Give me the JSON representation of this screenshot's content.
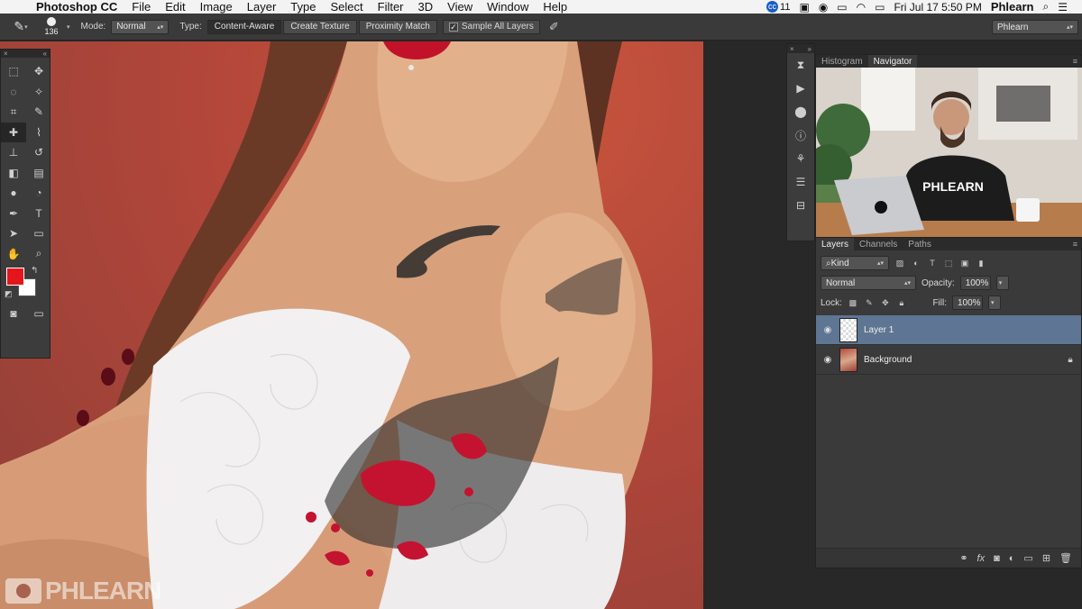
{
  "menubar": {
    "app_name": "Photoshop CC",
    "items": [
      "File",
      "Edit",
      "Image",
      "Layer",
      "Type",
      "Select",
      "Filter",
      "3D",
      "View",
      "Window",
      "Help"
    ],
    "cc_count": "11",
    "clock": "Fri Jul 17  5:50 PM",
    "user": "Phlearn"
  },
  "options": {
    "brush_size": "136",
    "mode_label": "Mode:",
    "mode_value": "Normal",
    "type_label": "Type:",
    "type_buttons": [
      "Content-Aware",
      "Create Texture",
      "Proximity Match"
    ],
    "sample_all_layers": "Sample All Layers",
    "workspace": "Phlearn"
  },
  "canvas": {
    "watermark": "PHLEARN"
  },
  "colors": {
    "foreground": "#e4161c",
    "background": "#ffffff",
    "selected_layer": "#5e7593"
  },
  "navigator": {
    "tabs": [
      "Histogram",
      "Navigator"
    ],
    "shirt_text": "PHLEARN"
  },
  "layers": {
    "tabs": [
      "Layers",
      "Channels",
      "Paths"
    ],
    "kind": "Kind",
    "blend_mode": "Normal",
    "opacity_label": "Opacity:",
    "opacity_value": "100%",
    "lock_label": "Lock:",
    "fill_label": "Fill:",
    "fill_value": "100%",
    "items": [
      {
        "name": "Layer 1"
      },
      {
        "name": "Background"
      }
    ]
  }
}
